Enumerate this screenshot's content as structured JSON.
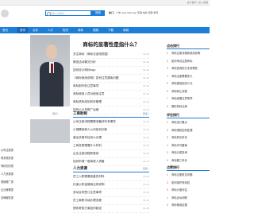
{
  "topbar": {
    "left": "",
    "right": "设为首页 | 加入收藏"
  },
  "header": {
    "search_placeholder": "请输入关键词",
    "search_button": "搜索",
    "hot_label": "热门：",
    "hot_terms": "广告 Java Web App 营销 电商 招聘 教育"
  },
  "nav": {
    "items": [
      "首页",
      "资讯",
      "点评",
      "人才",
      "知识",
      "商标",
      "视频",
      "下载",
      "商城"
    ],
    "active": "资讯"
  },
  "article": {
    "title": "商标的显著性是指什么？",
    "items": [
      {
        "t": "关注商标（商标法适用范围）",
        "d": "01-10"
      },
      {
        "t": "微信活动模式分析",
        "d": "01-10"
      },
      {
        "t": "如何设计商标logo",
        "d": "01-10"
      },
      {
        "t": "《商标使用说明》如何注意避免问题",
        "d": "01-10"
      },
      {
        "t": "商标制作前注意事项",
        "d": "01-10"
      },
      {
        "t": "商标使用人员对使用注意",
        "d": "01-10"
      },
      {
        "t": "商标资料库如何来管理",
        "d": "01-10"
      },
      {
        "t": "如何公众号推广运营",
        "d": "01-10"
      }
    ]
  },
  "section1": {
    "title": "工商财税",
    "more": "更多>",
    "items": [
      {
        "t": "公司注册流程需要准备材料有哪些",
        "d": "01-10"
      },
      {
        "t": "小规模纳税人公司如何记账",
        "d": "01-10"
      },
      {
        "t": "营业执照年检怎么办理",
        "d": "01-10"
      },
      {
        "t": "工商变更需要什么材料",
        "d": "01-10"
      },
      {
        "t": "企业注销流程和费用",
        "d": "01-10"
      },
      {
        "t": "如何申请一般纳税人资格",
        "d": "01-10"
      }
    ]
  },
  "section2": {
    "title": "人力资源",
    "more": "更多>",
    "items": [
      {
        "t": "员工入职需要准备的材料",
        "d": "01-10"
      },
      {
        "t": "社保公积金缴纳比例说明",
        "d": "01-10"
      },
      {
        "t": "劳动合同签订注意事项",
        "d": "01-10"
      },
      {
        "t": "员工离职手续办理流程",
        "d": "01-10"
      },
      {
        "t": "绩效考核方案如何制定",
        "d": "01-10"
      }
    ]
  },
  "left_more": "更多>",
  "left_items": [
    "公司注册类",
    "财务税务类",
    "商标知识类",
    "人力资源类",
    "营销推广类",
    "企业管理类",
    "法律服务类"
  ],
  "sidebar": {
    "block1_title": "点击排行",
    "block1": [
      "商标注册流程和费用说明",
      "如何申请注册商标",
      "商标查询的方法有哪些",
      "商标注册需要多久",
      "商标被驳回怎么办",
      "商标转让流程",
      "商标续展注意事项",
      "国际商标注册"
    ],
    "block2_title": "评论排行",
    "block2": [
      "商标设计要点",
      "商标侵权如何处理",
      "商标异议申请",
      "商标许可备案",
      "商标分类查询",
      "商标撤三申请"
    ],
    "block3_title": "点赞排行",
    "block3": [
      "商标注册常见问题",
      "如何保护商标权",
      "商标价值评估",
      "商标近似判断",
      "商标使用证据"
    ]
  }
}
